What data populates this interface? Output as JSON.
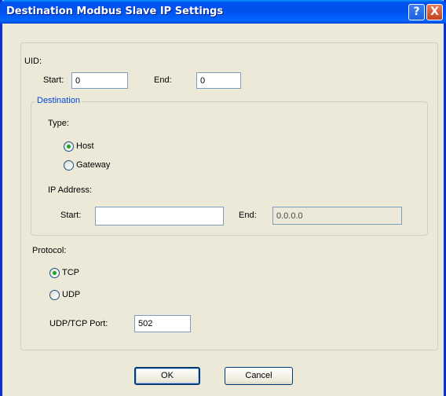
{
  "window": {
    "title": "Destination Modbus Slave IP Settings",
    "help_label": "?",
    "close_label": "X"
  },
  "uid": {
    "label": "UID:",
    "start_label": "Start:",
    "start_value": "0",
    "end_label": "End:",
    "end_value": "0"
  },
  "destination": {
    "legend": "Destination",
    "type_label": "Type:",
    "options": [
      {
        "label": "Host",
        "selected": true
      },
      {
        "label": "Gateway",
        "selected": false
      }
    ],
    "ip_label": "IP Address:",
    "ip_start_label": "Start:",
    "ip_start_value": "",
    "ip_end_label": "End:",
    "ip_end_value": "0.0.0.0"
  },
  "protocol": {
    "label": "Protocol:",
    "options": [
      {
        "label": "TCP",
        "selected": true
      },
      {
        "label": "UDP",
        "selected": false
      }
    ],
    "port_label": "UDP/TCP Port:",
    "port_value": "502"
  },
  "buttons": {
    "ok": "OK",
    "cancel": "Cancel"
  }
}
